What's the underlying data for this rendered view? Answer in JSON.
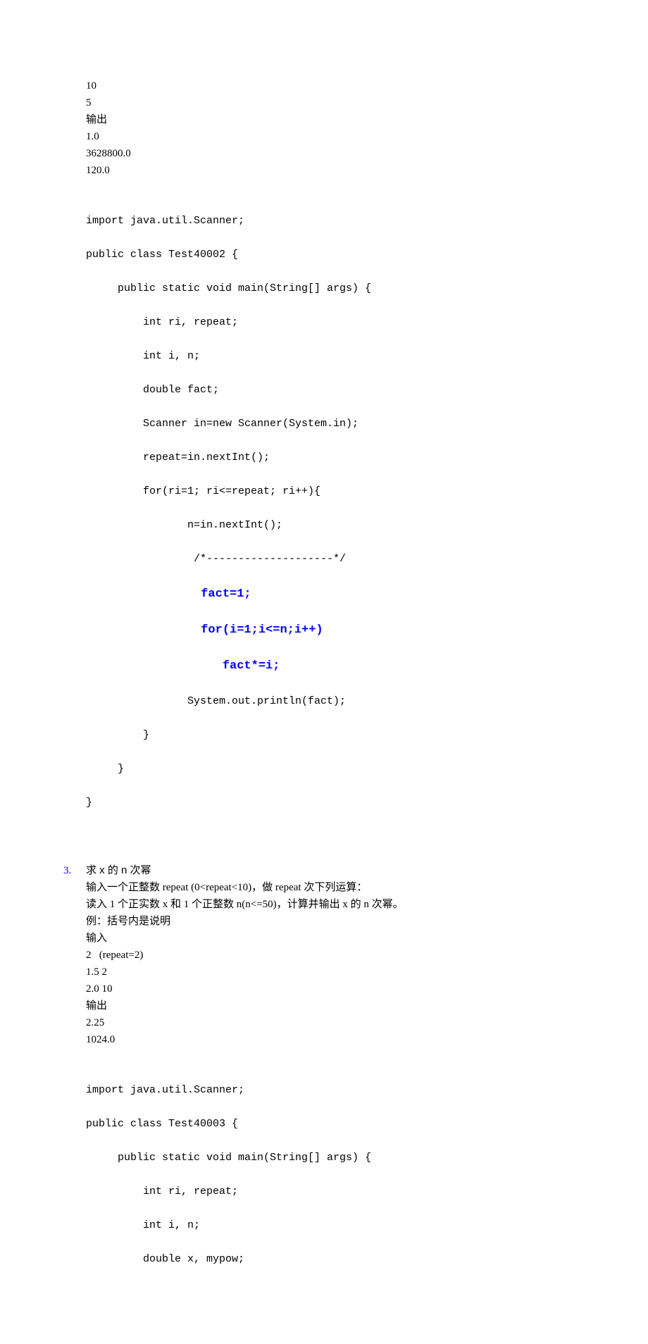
{
  "block1": {
    "lines": [
      "10",
      "5",
      "输出",
      "1.0",
      "3628800.0",
      "120.0"
    ]
  },
  "code1": {
    "l1": "import java.util.Scanner;",
    "l2": "public class Test40002 {",
    "l3": "     public static void main(String[] args) {",
    "l4": "         int ri, repeat;",
    "l5": "         int i, n;",
    "l6": "         double fact;",
    "l7": "         Scanner in=new Scanner(System.in);",
    "l8": "         repeat=in.nextInt();",
    "l9": "         for(ri=1; ri<=repeat; ri++){",
    "l10": "                n=in.nextInt();",
    "l11": "                 /*--------------------*/",
    "blue1": "                fact=1;",
    "blue2": "                for(i=1;i<=n;i++)",
    "blue3": "                   fact*=i;",
    "l12": "                System.out.println(fact);",
    "l13": "         }",
    "l14": "     }",
    "l15": "}"
  },
  "section3": {
    "num": "3.",
    "title": "求 x 的 n 次幂",
    "desc1": "输入一个正整数 repeat (0<repeat<10)，做 repeat 次下列运算：",
    "desc2": "读入 1 个正实数 x 和 1 个正整数 n(n<=50)，计算并输出 x 的 n 次幂。",
    "example": "例：括号内是说明",
    "input_label": "输入",
    "input1": "2   (repeat=2)",
    "input2": "1.5 2",
    "input3": "2.0 10",
    "output_label": "输出",
    "output1": "2.25",
    "output2": "1024.0"
  },
  "code2": {
    "l1": "import java.util.Scanner;",
    "l2": "public class Test40003 {",
    "l3": "     public static void main(String[] args) {",
    "l4": "         int ri, repeat;",
    "l5": "         int i, n;",
    "l6": "         double x, mypow;"
  }
}
